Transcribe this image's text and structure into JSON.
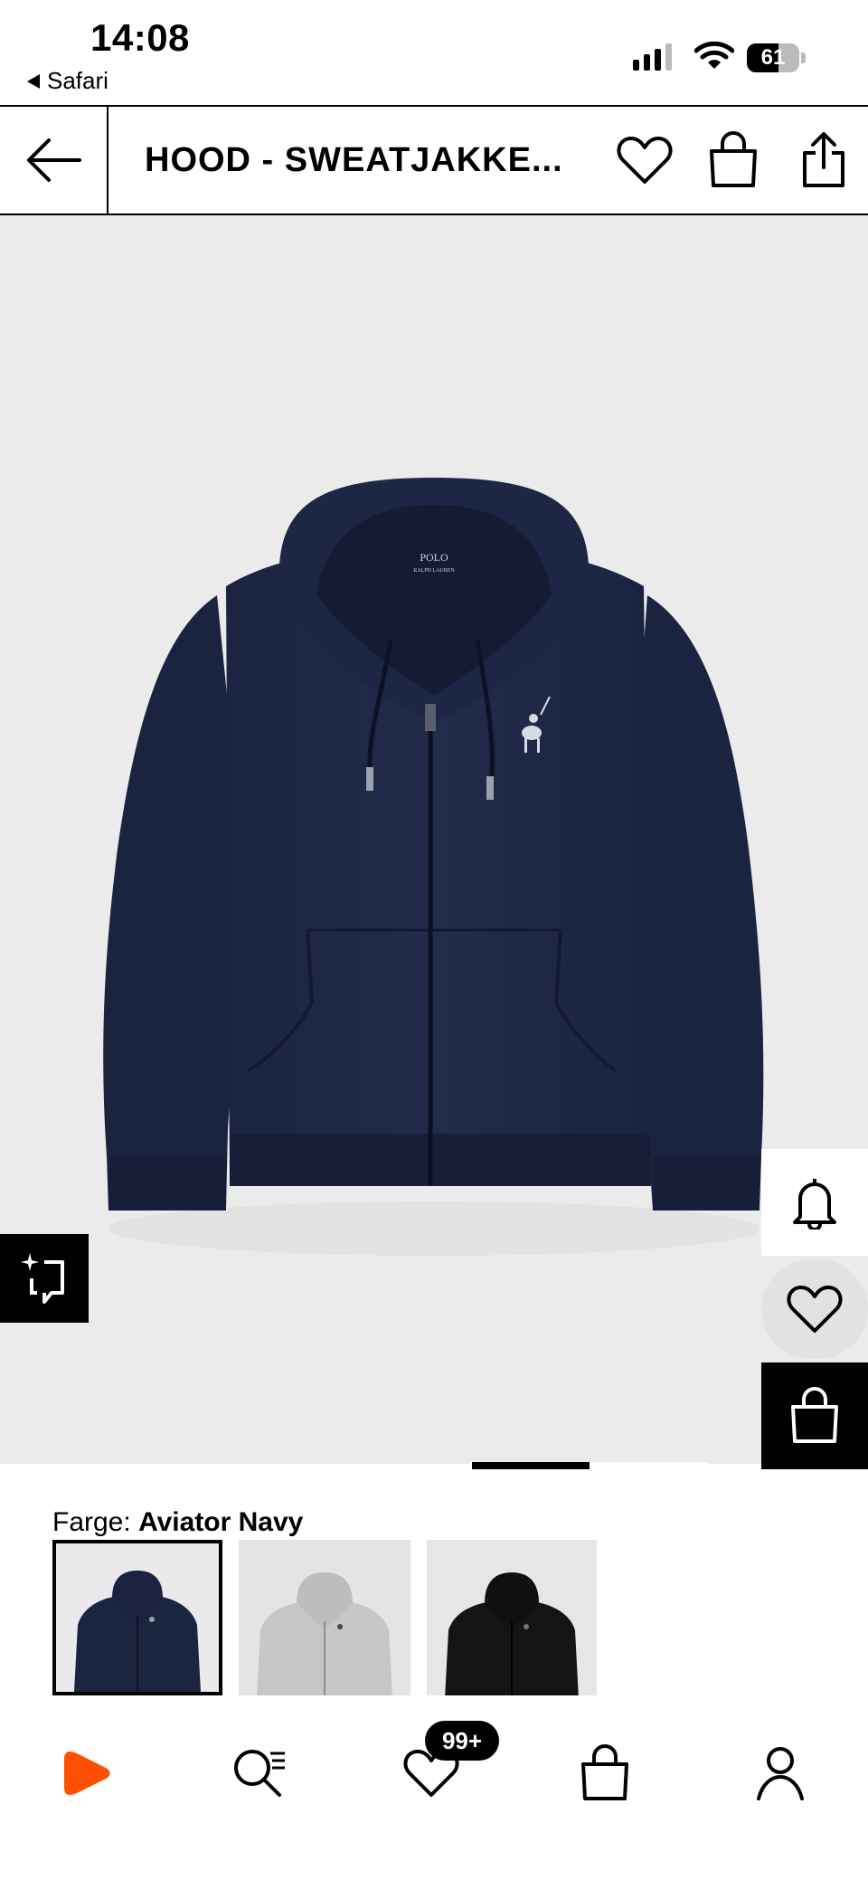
{
  "status_bar": {
    "time": "14:08",
    "back_app": "Safari",
    "battery": "61",
    "battery_level_percent": 61
  },
  "header": {
    "title": "HOOD - SWEATJAKKE...",
    "icons": [
      "arrow-left-icon",
      "heart-icon",
      "bag-icon",
      "share-icon"
    ]
  },
  "product": {
    "logo_text_1": "POLO",
    "logo_text_2": "RALPH LAUREN",
    "image_count": 2,
    "active_image": 1
  },
  "side_actions": {
    "icons": [
      "bell-icon",
      "heart-icon",
      "bag-icon"
    ]
  },
  "color": {
    "label": "Farge:",
    "selected": "Aviator Navy",
    "swatches": [
      {
        "name": "navy",
        "color": "#1c2540",
        "selected": true
      },
      {
        "name": "grey",
        "color": "#c9c9c9",
        "selected": false
      },
      {
        "name": "black",
        "color": "#151515",
        "selected": false
      }
    ]
  },
  "bottom_nav": {
    "icons": [
      "zalando-logo-icon",
      "search-icon",
      "wishlist-icon",
      "bag-icon",
      "profile-icon"
    ],
    "wishlist_badge": "99+",
    "brand_color": "#ff4f00"
  }
}
